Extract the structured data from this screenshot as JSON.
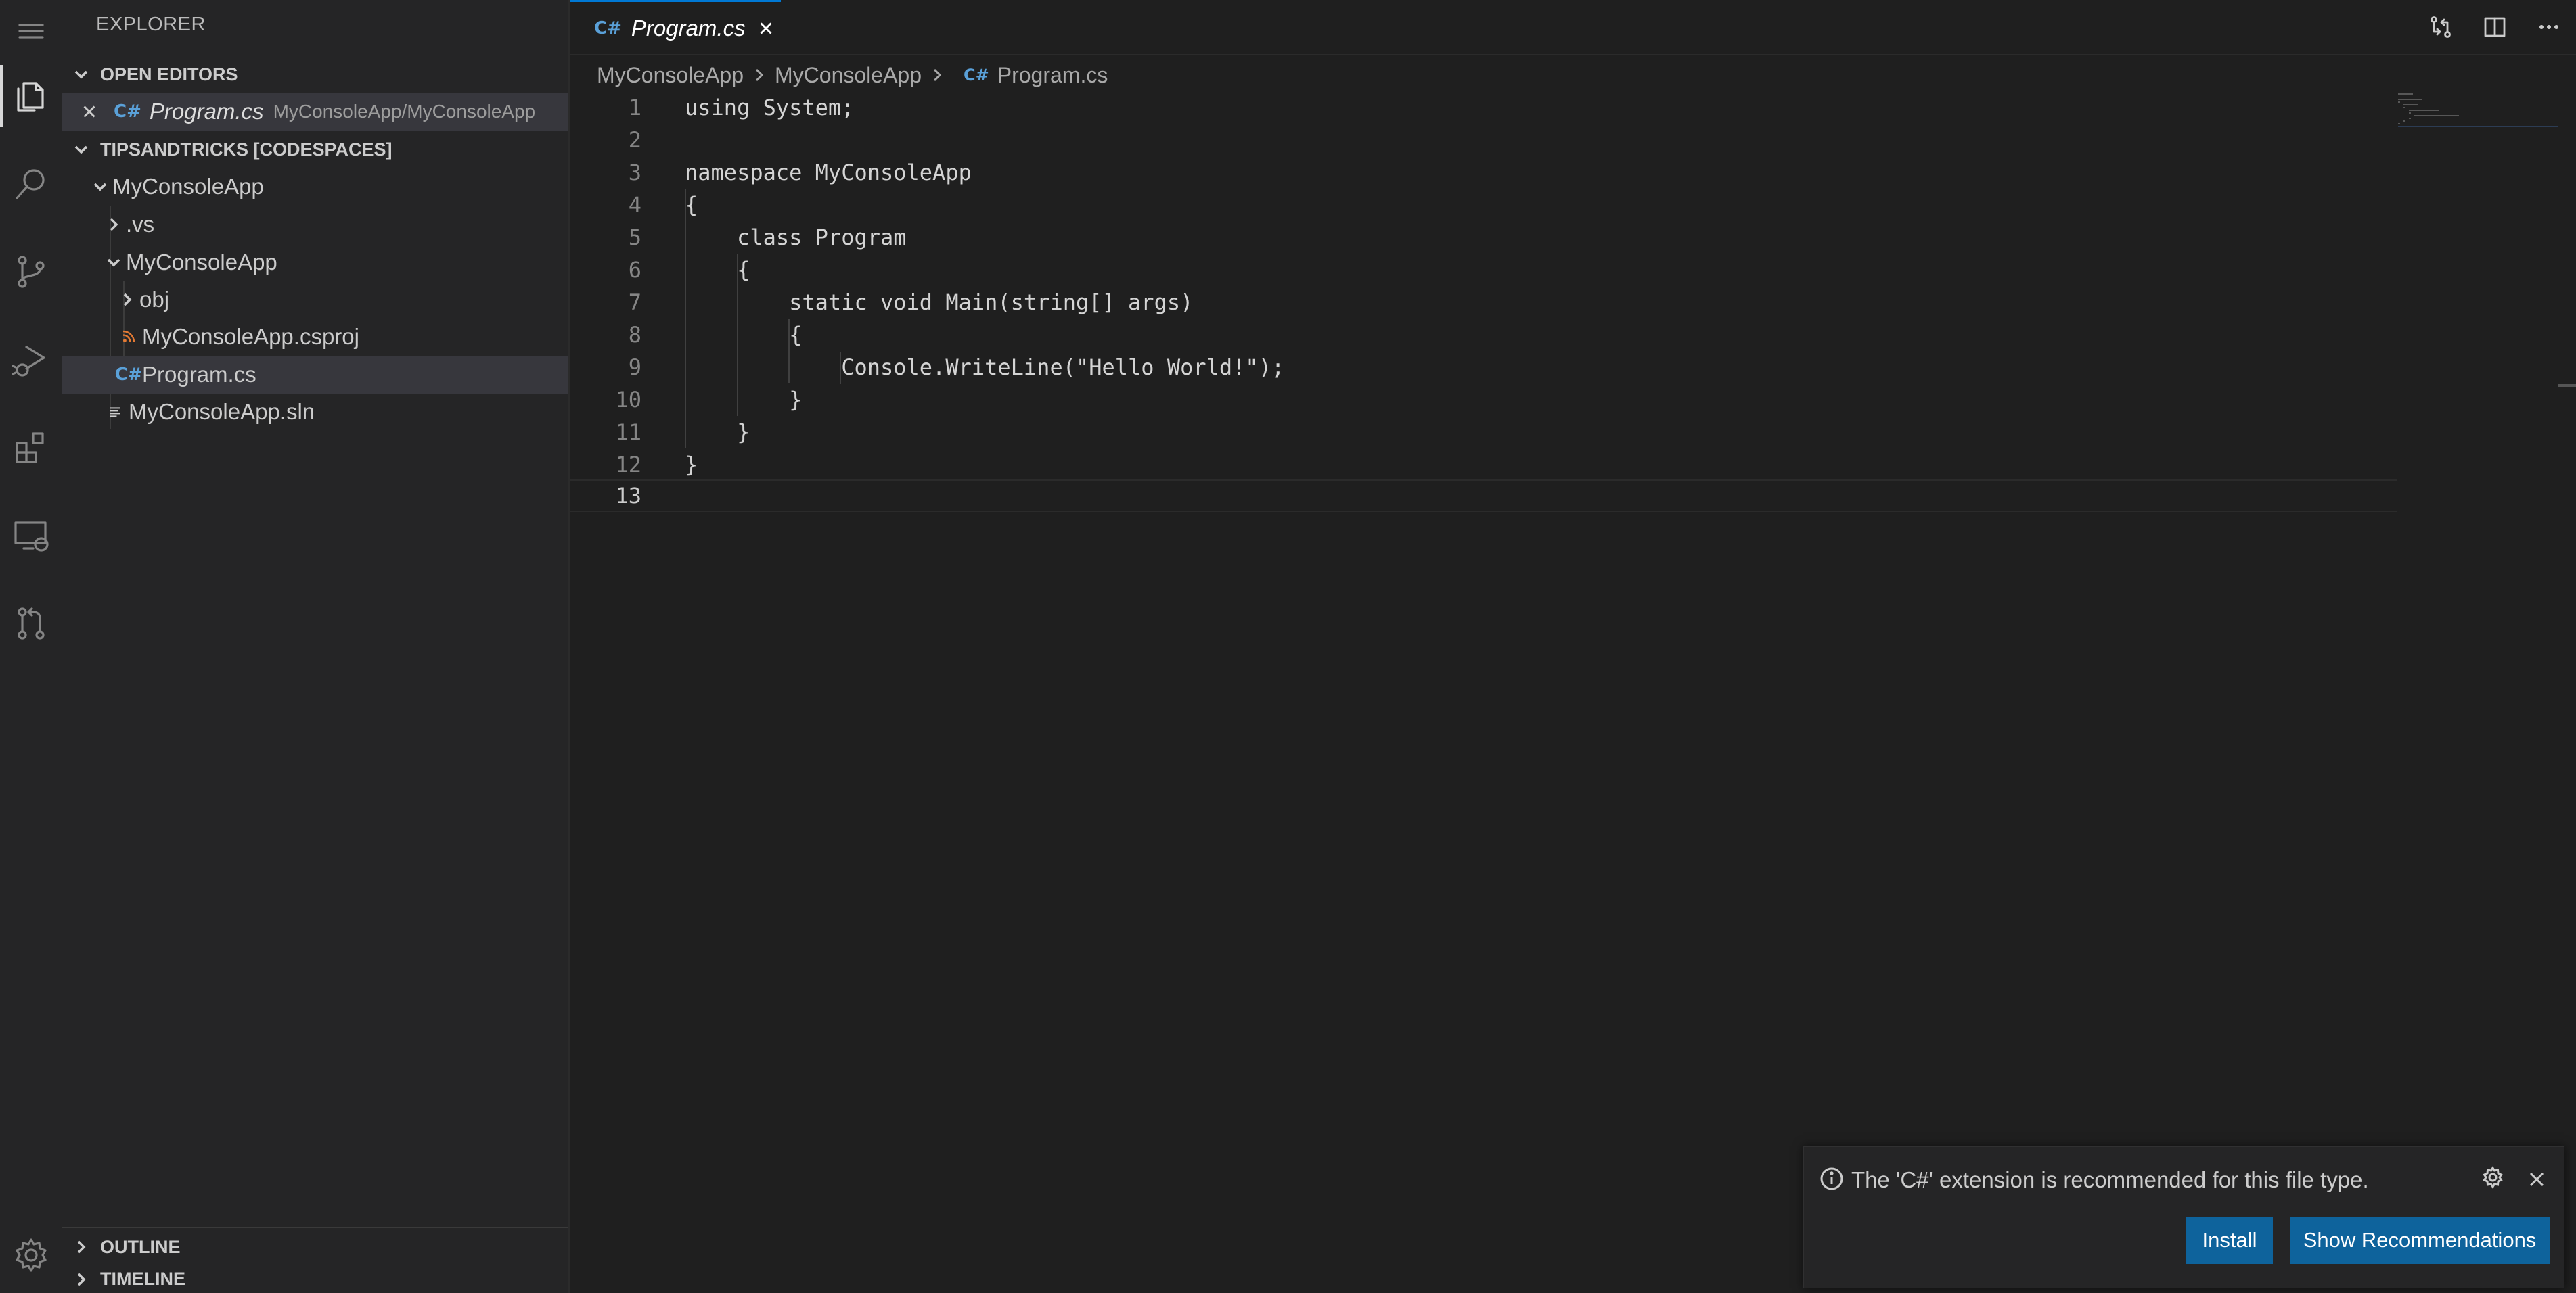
{
  "sidebar": {
    "title": "EXPLORER",
    "open_editors": {
      "label": "OPEN EDITORS",
      "items": [
        {
          "name": "Program.cs",
          "path": "MyConsoleApp/MyConsoleApp"
        }
      ]
    },
    "workspace": {
      "label": "TIPSANDTRICKS [CODESPACES]",
      "tree": [
        {
          "label": "MyConsoleApp",
          "type": "folder-open"
        },
        {
          "label": ".vs",
          "type": "folder-closed"
        },
        {
          "label": "MyConsoleApp",
          "type": "folder-open"
        },
        {
          "label": "obj",
          "type": "folder-closed"
        },
        {
          "label": "MyConsoleApp.csproj",
          "type": "rss-icon"
        },
        {
          "label": "Program.cs",
          "type": "csharp-icon"
        },
        {
          "label": "MyConsoleApp.sln",
          "type": "lines-icon"
        }
      ]
    },
    "outline_label": "OUTLINE",
    "timeline_label": "TIMELINE"
  },
  "tab": {
    "label": "Program.cs"
  },
  "breadcrumb": [
    "MyConsoleApp",
    "MyConsoleApp",
    "Program.cs"
  ],
  "code": {
    "lines": [
      "using System;",
      "",
      "namespace MyConsoleApp",
      "{",
      "    class Program",
      "    {",
      "        static void Main(string[] args)",
      "        {",
      "            Console.WriteLine(\"Hello World!\");",
      "        }",
      "    }",
      "}",
      ""
    ],
    "line_numbers": [
      "1",
      "2",
      "3",
      "4",
      "5",
      "6",
      "7",
      "8",
      "9",
      "10",
      "11",
      "12",
      "13"
    ],
    "current_line": 13
  },
  "notification": {
    "message": "The 'C#' extension is recommended for this file type.",
    "install_label": "Install",
    "show_recommendations_label": "Show Recommendations"
  },
  "colors": {
    "background": "#1f1f1f",
    "sidebar": "#252526",
    "button": "#0e639c",
    "csharp_icon": "#5aa0d8",
    "rss_icon": "#e37933"
  }
}
